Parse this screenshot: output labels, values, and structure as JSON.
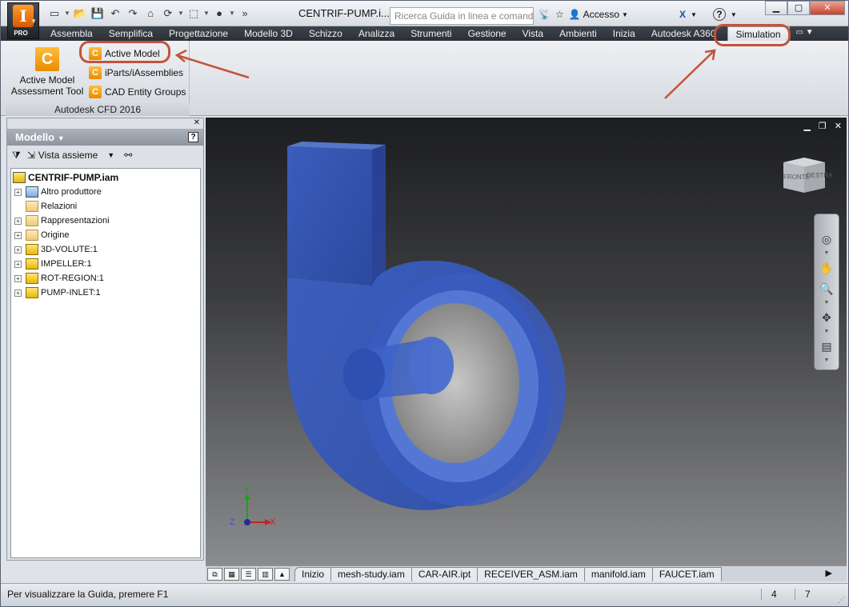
{
  "app": {
    "badge": "PRO",
    "doc_title": "CENTRIF-PUMP.i...",
    "search_placeholder": "Ricerca Guida in linea e comand",
    "sign_in": "Accesso",
    "help_glyph": "?"
  },
  "ribbon": {
    "tabs": [
      "Assembla",
      "Semplifica",
      "Progettazione",
      "Modello 3D",
      "Schizzo",
      "Analizza",
      "Strumenti",
      "Gestione",
      "Vista",
      "Ambienti",
      "Inizia",
      "Autodesk A360",
      "Simulation"
    ],
    "active_tab": "Simulation",
    "panel": {
      "large_button": "Active Model Assessment Tool",
      "buttons": [
        "Active Model",
        "iParts/iAssemblies",
        "CAD Entity Groups"
      ],
      "name": "Autodesk CFD 2016"
    }
  },
  "browser": {
    "title": "Modello",
    "view_mode": "Vista assieme",
    "root": "CENTRIF-PUMP.iam",
    "nodes": [
      {
        "label": "Altro produttore",
        "icon": "external-icon",
        "expandable": true
      },
      {
        "label": "Relazioni",
        "icon": "folder-icon",
        "expandable": false
      },
      {
        "label": "Rappresentazioni",
        "icon": "representations-icon",
        "expandable": true
      },
      {
        "label": "Origine",
        "icon": "folder-icon",
        "expandable": true
      },
      {
        "label": "3D-VOLUTE:1",
        "icon": "part-icon",
        "expandable": true
      },
      {
        "label": "IMPELLER:1",
        "icon": "part-icon",
        "expandable": true
      },
      {
        "label": "ROT-REGION:1",
        "icon": "part-icon",
        "expandable": true
      },
      {
        "label": "PUMP-INLET:1",
        "icon": "part-icon",
        "expandable": true
      }
    ]
  },
  "viewport": {
    "viewcube_faces": [
      "FRONTE",
      "DESTRA"
    ],
    "axes": [
      "Y",
      "Z",
      "X"
    ],
    "model_color": "#3b5fc4"
  },
  "doc_tabs": [
    "Inizio",
    "mesh-study.iam",
    "CAR-AIR.ipt",
    "RECEIVER_ASM.iam",
    "manifold.iam",
    "FAUCET.iam"
  ],
  "status": {
    "message": "Per visualizzare la Guida, premere F1",
    "count1": "4",
    "count2": "7"
  }
}
